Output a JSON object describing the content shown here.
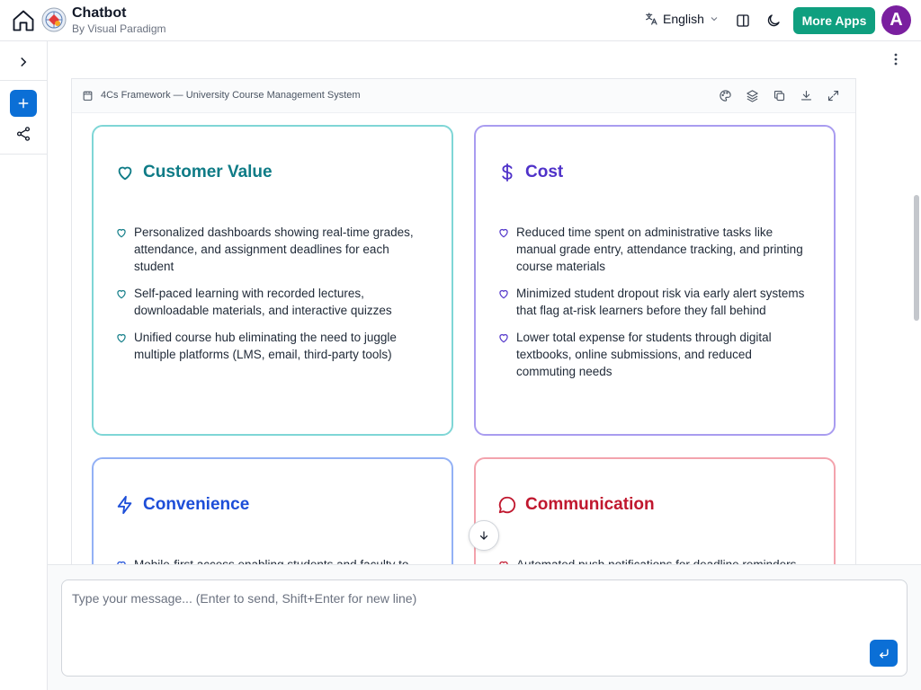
{
  "app": {
    "title": "Chatbot",
    "subtitle": "By Visual Paradigm"
  },
  "header": {
    "language": "English",
    "more_apps": "More Apps",
    "avatar_initial": "A",
    "icons": [
      "home-icon",
      "translate-icon",
      "chevron-down-icon",
      "panel-toggle-icon",
      "moon-icon"
    ]
  },
  "panel": {
    "title": "4Cs Framework — University Course Management System",
    "tools": [
      "palette-icon",
      "layers-icon",
      "copy-icon",
      "download-icon",
      "expand-icon"
    ]
  },
  "cards": {
    "customer_value": {
      "title": "Customer Value",
      "color": "#0e7b86",
      "border": "#7fd6d6",
      "icon": "heart-icon",
      "items": [
        "Personalized dashboards showing real-time grades, attendance, and assignment deadlines for each student",
        "Self-paced learning with recorded lectures, downloadable materials, and interactive quizzes",
        "Unified course hub eliminating the need to juggle multiple platforms (LMS, email, third-party tools)"
      ]
    },
    "cost": {
      "title": "Cost",
      "color": "#4f32c9",
      "border": "#a99cf0",
      "icon": "dollar-icon",
      "items": [
        "Reduced time spent on administrative tasks like manual grade entry, attendance tracking, and printing course materials",
        "Minimized student dropout risk via early alert systems that flag at-risk learners before they fall behind",
        "Lower total expense for students through digital textbooks, online submissions, and reduced commuting needs"
      ]
    },
    "convenience": {
      "title": "Convenience",
      "color": "#1d4ed8",
      "border": "#93b1f5",
      "icon": "lightning-icon",
      "items": [
        "Mobile-first access enabling students and faculty to"
      ]
    },
    "communication": {
      "title": "Communication",
      "color": "#c0172e",
      "border": "#f3a3ad",
      "icon": "chat-bubble-icon",
      "items": [
        "Automated push notifications for deadline reminders"
      ]
    }
  },
  "composer": {
    "placeholder": "Type your message... (Enter to send, Shift+Enter for new line)"
  },
  "colors": {
    "accent": "#0b6fd6",
    "more_apps": "#0f9f7f",
    "avatar": "#7a1f9f"
  }
}
